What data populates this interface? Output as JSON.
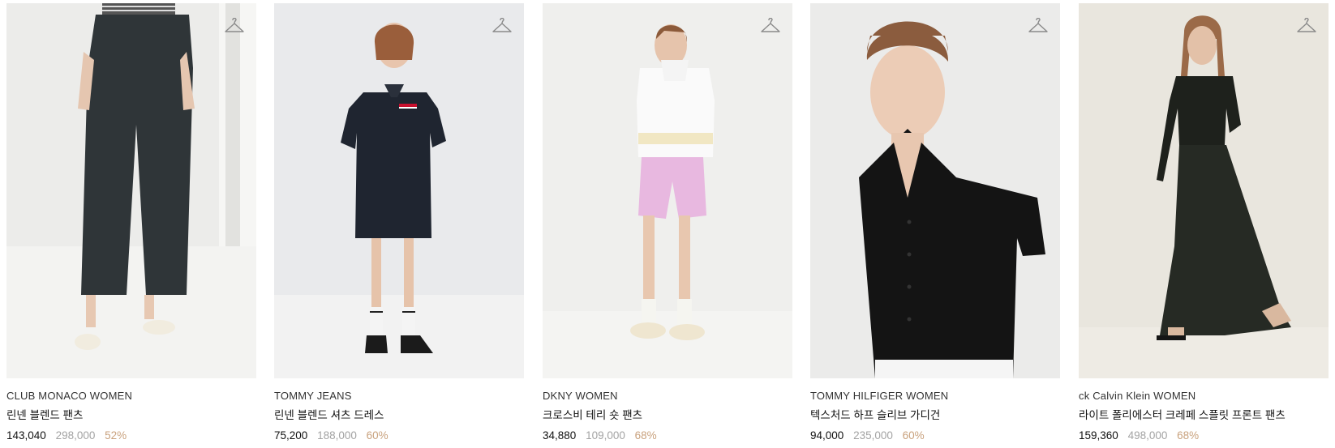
{
  "products": [
    {
      "brand": "CLUB MONACO WOMEN",
      "name": "린넨 블렌드 팬츠",
      "price": "143,040",
      "original_price": "298,000",
      "discount": "52%",
      "wish_icon": "hanger-icon",
      "image": "model-wearing-dark-linen-pants"
    },
    {
      "brand": "TOMMY JEANS",
      "name": "린넨 블렌드 셔츠 드레스",
      "price": "75,200",
      "original_price": "188,000",
      "discount": "60%",
      "wish_icon": "hanger-icon",
      "image": "model-wearing-navy-shirt-dress"
    },
    {
      "brand": "DKNY WOMEN",
      "name": "크로스비 테리 숏 팬츠",
      "price": "34,880",
      "original_price": "109,000",
      "discount": "68%",
      "wish_icon": "hanger-icon",
      "image": "model-wearing-pink-shorts-white-hoodie"
    },
    {
      "brand": "TOMMY HILFIGER WOMEN",
      "name": "텍스처드 하프 슬리브 가디건",
      "price": "94,000",
      "original_price": "235,000",
      "discount": "60%",
      "wish_icon": "hanger-icon",
      "image": "model-wearing-black-knit-cardigan"
    },
    {
      "brand": "ck Calvin Klein WOMEN",
      "name": "라이트 폴리에스터 크레페 스플릿 프론트 팬츠",
      "price": "159,360",
      "original_price": "498,000",
      "discount": "68%",
      "wish_icon": "hanger-icon",
      "image": "model-wearing-black-wide-pants"
    }
  ],
  "colors": {
    "price": "#111111",
    "original_price": "#a3a3a3",
    "discount": "#c9a27e"
  }
}
